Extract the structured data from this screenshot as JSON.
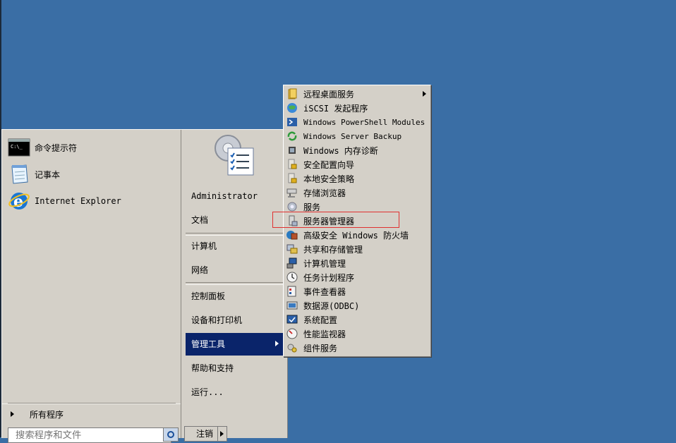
{
  "start_menu": {
    "pinned": [
      {
        "label": "命令提示符",
        "icon": "cmd-icon"
      },
      {
        "label": "记事本",
        "icon": "notepad-icon"
      },
      {
        "label": "Internet Explorer",
        "icon": "ie-icon"
      }
    ],
    "all_programs": "所有程序",
    "search_placeholder": "搜索程序和文件",
    "right": {
      "user": "Administrator",
      "documents": "文档",
      "computer": "计算机",
      "network": "网络",
      "control_panel": "控制面板",
      "devices_printers": "设备和打印机",
      "admin_tools": "管理工具",
      "help": "帮助和支持",
      "run": "运行..."
    },
    "logoff": "注销"
  },
  "submenu": {
    "items": [
      {
        "label": "远程桌面服务",
        "icon": "folder-icon",
        "has_submenu": true
      },
      {
        "label": "iSCSI 发起程序",
        "icon": "globe-icon"
      },
      {
        "label": "Windows PowerShell Modules",
        "icon": "powershell-icon"
      },
      {
        "label": "Windows Server Backup",
        "icon": "backup-icon"
      },
      {
        "label": "Windows 内存诊断",
        "icon": "memory-icon"
      },
      {
        "label": "安全配置向导",
        "icon": "security-wizard-icon"
      },
      {
        "label": "本地安全策略",
        "icon": "security-policy-icon"
      },
      {
        "label": "存储浏览器",
        "icon": "storage-icon"
      },
      {
        "label": "服务",
        "icon": "services-gear-icon"
      },
      {
        "label": "服务器管理器",
        "icon": "server-manager-icon"
      },
      {
        "label": "高级安全 Windows 防火墙",
        "icon": "firewall-icon"
      },
      {
        "label": "共享和存储管理",
        "icon": "share-storage-icon"
      },
      {
        "label": "计算机管理",
        "icon": "computer-management-icon"
      },
      {
        "label": "任务计划程序",
        "icon": "clock-icon"
      },
      {
        "label": "事件查看器",
        "icon": "event-viewer-icon"
      },
      {
        "label": "数据源(ODBC)",
        "icon": "odbc-icon"
      },
      {
        "label": "系统配置",
        "icon": "system-config-icon"
      },
      {
        "label": "性能监视器",
        "icon": "performance-icon"
      },
      {
        "label": "组件服务",
        "icon": "component-icon"
      }
    ]
  }
}
